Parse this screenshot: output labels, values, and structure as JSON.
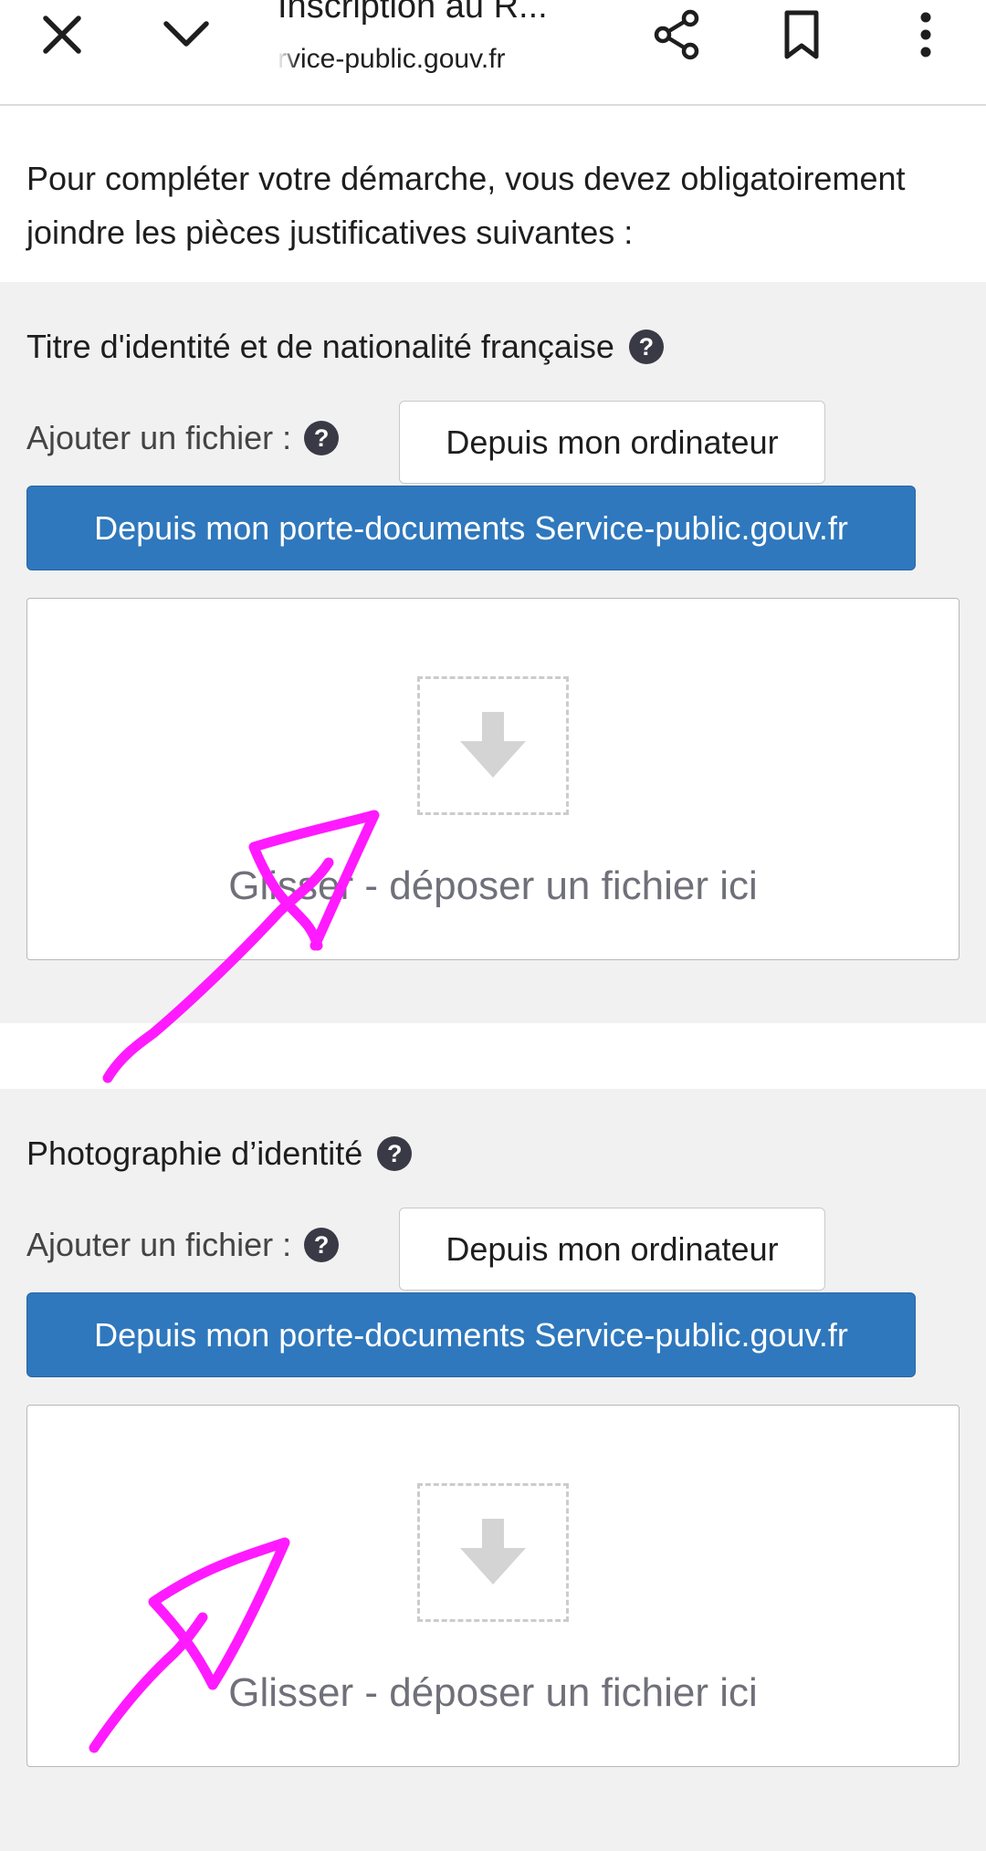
{
  "browser": {
    "page_title": "Inscription au R...",
    "url": "rvice-public.gouv.fr",
    "icons": [
      "close-icon",
      "chevron-down-icon",
      "share-icon",
      "bookmark-icon",
      "more-vert-icon"
    ]
  },
  "intro": {
    "text": "Pour compléter votre démarche, vous devez obligatoirement joindre les pièces justificatives suivantes :"
  },
  "sections": [
    {
      "label": "Titre d'identité et de nationalité française",
      "help": "?",
      "add_file_label": "Ajouter un fichier :",
      "add_help": "?",
      "computer_button": "Depuis mon ordinateur",
      "portfolio_button": "Depuis mon porte-documents Service-public.gouv.fr",
      "dropzone_text": "Glisser - déposer un fichier ici"
    },
    {
      "label": "Photographie d’identité",
      "help": "?",
      "add_file_label": "Ajouter un fichier :",
      "add_help": "?",
      "computer_button": "Depuis mon ordinateur",
      "portfolio_button": "Depuis mon porte-documents Service-public.gouv.fr",
      "dropzone_text": "Glisser - déposer un fichier ici"
    }
  ],
  "colors": {
    "primary_button": "#2f78bd",
    "section_bg": "#f1f1f1",
    "annotation": "#ff1aff"
  }
}
